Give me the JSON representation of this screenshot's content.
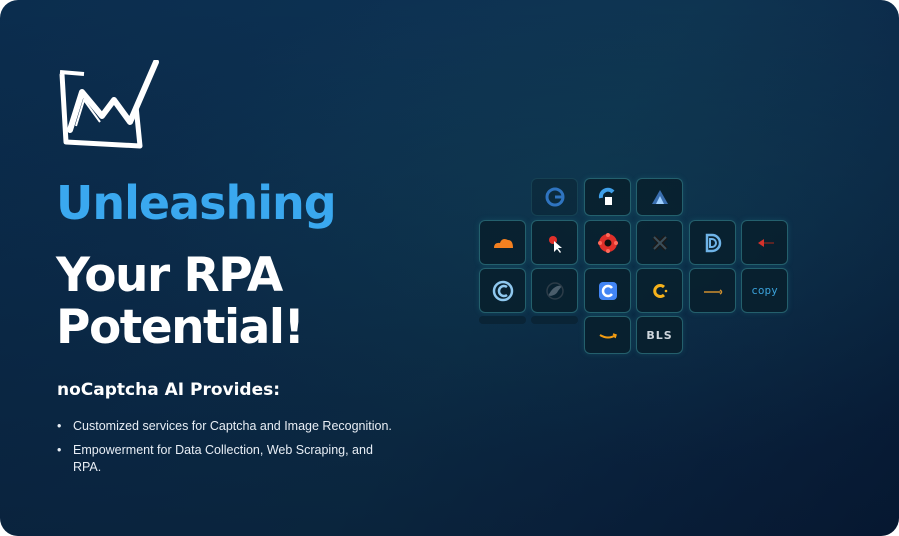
{
  "hero": {
    "headline_line1": "Unleashing",
    "headline_line2": "Your RPA Potential!",
    "subhead": "noCaptcha AI Provides:",
    "bullets": [
      "Customized services for Captcha and Image Recognition.",
      "Empowerment for Data Collection, Web Scraping, and RPA."
    ]
  },
  "logo": {
    "icon": "nocaptcha-logo-icon"
  },
  "tiles": [
    {
      "icon": "captcha-g-icon"
    },
    {
      "icon": "funcaptcha-icon"
    },
    {
      "icon": "aws-waf-icon"
    },
    {
      "icon": "cloudflare-icon"
    },
    {
      "icon": "cursor-click-icon"
    },
    {
      "icon": "red-flower-icon"
    },
    {
      "icon": "x-puzzle-icon"
    },
    {
      "icon": "datadome-icon"
    },
    {
      "icon": "red-arrows-icon"
    },
    {
      "icon": "shield-c-icon"
    },
    {
      "icon": "bird-icon"
    },
    {
      "icon": "recaptcha-icon"
    },
    {
      "icon": "coinbase-c-icon"
    },
    {
      "icon": "amazon-bar-icon"
    },
    {
      "icon": "copy-icon",
      "label": "copy"
    },
    {
      "icon": "amazon-icon"
    },
    {
      "icon": "bls-icon",
      "label": "BLS"
    }
  ],
  "colors": {
    "accent": "#3aa8ef",
    "background": "#0c2f50",
    "tile_border": "#3c96a0"
  }
}
